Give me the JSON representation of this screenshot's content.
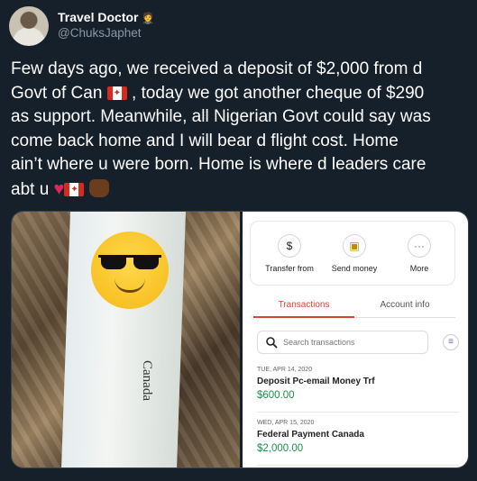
{
  "author": {
    "name": "Travel Doctor",
    "badge_icon": "person-in-tuxedo-icon",
    "handle": "@ChuksJaphet"
  },
  "tweet": {
    "line1": "Few days ago, we received a deposit of $2,000 from d",
    "line2a": "Govt of Can",
    "line2b": ", today we got another cheque of $290",
    "line3": "as support. Meanwhile, all Nigerian Govt could say was",
    "line4": "come back home and I will bear d flight cost. Home",
    "line5": "ain’t  where u were born. Home is where d leaders care",
    "line6": "abt u"
  },
  "photo": {
    "cheque_text": "Canada"
  },
  "bank_app": {
    "quick_actions": [
      {
        "label": "Transfer from",
        "icon": "dollar-transfer-icon",
        "glyph": "$"
      },
      {
        "label": "Send money",
        "icon": "send-money-icon",
        "glyph": "▣"
      },
      {
        "label": "More",
        "icon": "more-dots-icon",
        "glyph": "···"
      }
    ],
    "tabs": {
      "active": "Transactions",
      "inactive": "Account info"
    },
    "search_placeholder": "Search transactions",
    "transactions": [
      {
        "date": "TUE, APR 14, 2020",
        "description": "Deposit Pc-email Money Trf",
        "amount": "$600.00"
      },
      {
        "date": "WED, APR 15, 2020",
        "description": "Federal Payment Canada",
        "amount": "$2,000.00"
      }
    ],
    "accent_color": "#d6452e",
    "amount_color": "#1f8f4a"
  }
}
